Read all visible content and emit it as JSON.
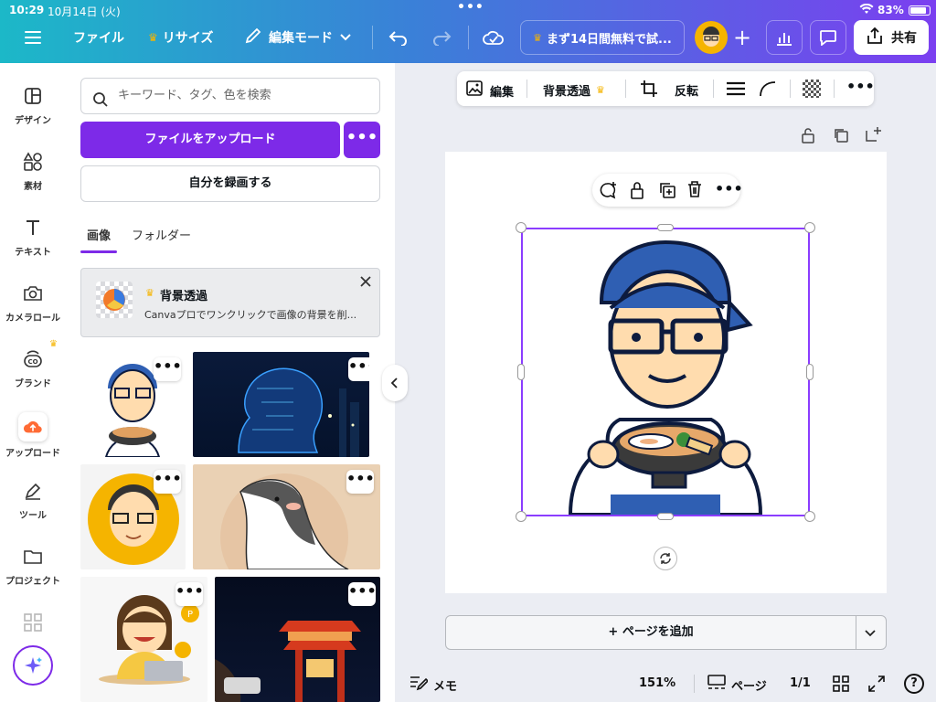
{
  "status": {
    "time": "10:29",
    "date": "10月14日 (火)",
    "battery": "83%"
  },
  "topbar": {
    "menu_icon": "hamburger-icon",
    "file": "ファイル",
    "resize": "リサイズ",
    "edit_mode": "編集モード",
    "trial": "まず14日間無料で試...",
    "share": "共有",
    "accent": "#7d2ae8"
  },
  "sidebar": {
    "items": [
      {
        "label": "デザイン",
        "icon": "design-icon"
      },
      {
        "label": "素材",
        "icon": "elements-icon"
      },
      {
        "label": "テキスト",
        "icon": "text-icon"
      },
      {
        "label": "カメラロール",
        "icon": "camera-icon"
      },
      {
        "label": "ブランド",
        "icon": "brand-icon"
      },
      {
        "label": "アップロード",
        "icon": "upload-icon"
      },
      {
        "label": "ツール",
        "icon": "tools-icon"
      },
      {
        "label": "プロジェクト",
        "icon": "folder-icon"
      }
    ]
  },
  "panel": {
    "search_placeholder": "キーワード、タグ、色を検索",
    "upload_button": "ファイルをアップロード",
    "more": "•••",
    "record_button": "自分を録画する",
    "tabs": [
      "画像",
      "フォルダー"
    ],
    "promo": {
      "title": "背景透過",
      "text": "Canvaプロでワンクリックで画像の背景を削..."
    }
  },
  "toolbar": {
    "edit": "編集",
    "bg_remove": "背景透過",
    "flip": "反転"
  },
  "canvas": {
    "add_page": "+ ページを追加"
  },
  "bottom": {
    "memo": "メモ",
    "zoom": "151%",
    "pages": "ページ",
    "page_count": "1/1"
  }
}
